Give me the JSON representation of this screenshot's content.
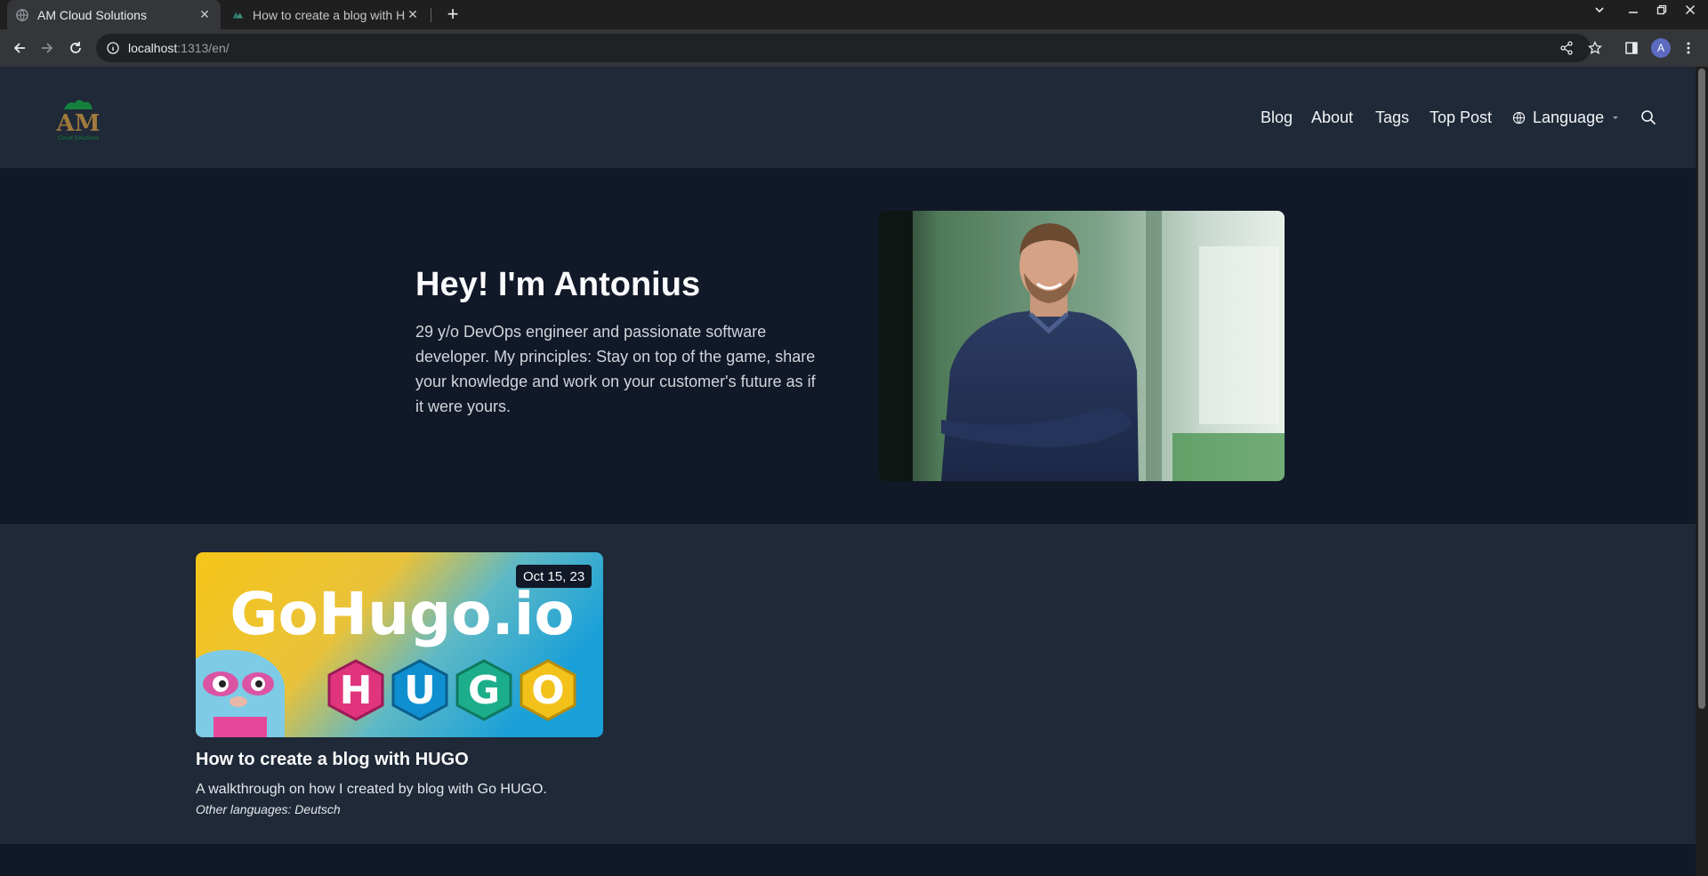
{
  "browser": {
    "tabs": [
      {
        "title": "AM Cloud Solutions",
        "active": true
      },
      {
        "title": "How to create a blog with HUGO",
        "active": false
      }
    ],
    "address": {
      "host": "localhost",
      "rest": ":1313/en/"
    },
    "profile_initial": "A"
  },
  "header": {
    "logo_text": "AM",
    "logo_subtext": "Cloud Solutions",
    "nav": [
      "Blog",
      "About",
      "Tags",
      "Top Post"
    ],
    "language_label": "Language"
  },
  "hero": {
    "title": "Hey! I'm Antonius",
    "text": "29 y/o DevOps engineer and passionate software developer. My principles: Stay on top of the game, share your knowledge and work on your customer's future as if it were yours."
  },
  "posts": [
    {
      "date": "Oct 15, 23",
      "title": "How to create a blog with HUGO",
      "description": "A walkthrough on how I created by blog with Go HUGO.",
      "other_languages_label": "Other languages:",
      "other_languages": [
        "Deutsch"
      ],
      "image_text": "GoHugo.io",
      "image_letters": [
        "H",
        "U",
        "G",
        "O"
      ]
    }
  ],
  "colors": {
    "header_bg": "#1f2937",
    "hero_bg": "#111827",
    "logo_green": "#15803d",
    "logo_gold": "#a07a3c"
  }
}
